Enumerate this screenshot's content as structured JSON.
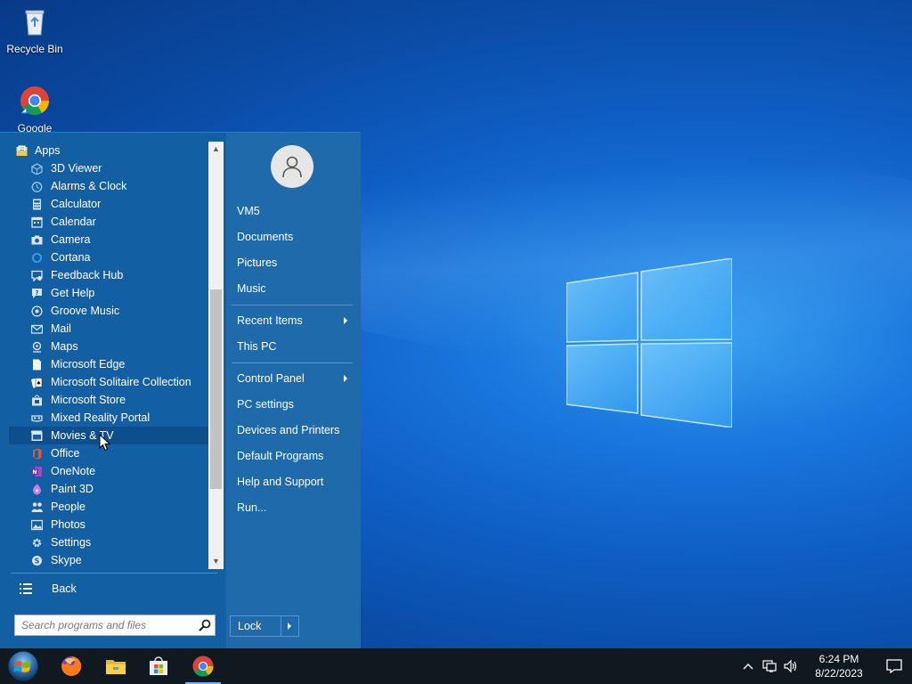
{
  "desktop": {
    "icons": [
      {
        "label": "Recycle Bin",
        "icon": "recycle-bin-icon"
      },
      {
        "label": "Google",
        "icon": "chrome-icon"
      }
    ]
  },
  "start_menu": {
    "apps_folder": "Apps",
    "apps": [
      {
        "label": "3D Viewer",
        "icon": "cube-icon",
        "color": "#8fc3f0"
      },
      {
        "label": "Alarms & Clock",
        "icon": "clock-icon",
        "color": "#8fc3f0"
      },
      {
        "label": "Calculator",
        "icon": "calculator-icon",
        "color": "#d8e6f4"
      },
      {
        "label": "Calendar",
        "icon": "calendar-icon",
        "color": "#d8e6f4"
      },
      {
        "label": "Camera",
        "icon": "camera-icon",
        "color": "#d8e6f4"
      },
      {
        "label": "Cortana",
        "icon": "ring-icon",
        "color": "#3b9cf0"
      },
      {
        "label": "Feedback Hub",
        "icon": "feedback-icon",
        "color": "#d8e6f4"
      },
      {
        "label": "Get Help",
        "icon": "help-icon",
        "color": "#d8e6f4"
      },
      {
        "label": "Groove Music",
        "icon": "music-icon",
        "color": "#d8e6f4"
      },
      {
        "label": "Mail",
        "icon": "mail-icon",
        "color": "#d8e6f4"
      },
      {
        "label": "Maps",
        "icon": "map-pin-icon",
        "color": "#d8e6f4"
      },
      {
        "label": "Microsoft Edge",
        "icon": "page-icon",
        "color": "#f4f4f4"
      },
      {
        "label": "Microsoft Solitaire Collection",
        "icon": "cards-icon",
        "color": "#f4f4f4"
      },
      {
        "label": "Microsoft Store",
        "icon": "store-icon",
        "color": "#d8e6f4"
      },
      {
        "label": "Mixed Reality Portal",
        "icon": "headset-icon",
        "color": "#d8e6f4"
      },
      {
        "label": "Movies & TV",
        "icon": "film-icon",
        "color": "#d8e6f4",
        "selected": true
      },
      {
        "label": "Office",
        "icon": "office-icon",
        "color": "#e8542c"
      },
      {
        "label": "OneNote",
        "icon": "onenote-icon",
        "color": "#9a4ec4"
      },
      {
        "label": "Paint 3D",
        "icon": "paint-icon",
        "color": "#c87be8"
      },
      {
        "label": "People",
        "icon": "people-icon",
        "color": "#d8e6f4"
      },
      {
        "label": "Photos",
        "icon": "photo-icon",
        "color": "#d8e6f4"
      },
      {
        "label": "Settings",
        "icon": "gear-icon",
        "color": "#d8e6f4"
      },
      {
        "label": "Skype",
        "icon": "skype-icon",
        "color": "#d8e6f4"
      }
    ],
    "back_label": "Back",
    "search_placeholder": "Search programs and files",
    "right": {
      "user": "VM5",
      "items": [
        {
          "label": "Documents"
        },
        {
          "label": "Pictures"
        },
        {
          "label": "Music"
        },
        {
          "label": "Recent Items",
          "submenu": true
        },
        {
          "label": "This PC"
        },
        {
          "label": "Control Panel",
          "submenu": true
        },
        {
          "label": "PC settings"
        },
        {
          "label": "Devices and Printers"
        },
        {
          "label": "Default Programs"
        },
        {
          "label": "Help and Support"
        },
        {
          "label": "Run..."
        }
      ],
      "lock_label": "Lock"
    }
  },
  "taskbar": {
    "apps": [
      {
        "name": "firefox",
        "icon": "firefox-icon"
      },
      {
        "name": "file-explorer",
        "icon": "folder-icon"
      },
      {
        "name": "microsoft-store",
        "icon": "store-bag-icon"
      },
      {
        "name": "chrome",
        "icon": "chrome-icon",
        "active": true
      }
    ],
    "clock": {
      "time": "6:24 PM",
      "date": "8/22/2023"
    }
  }
}
